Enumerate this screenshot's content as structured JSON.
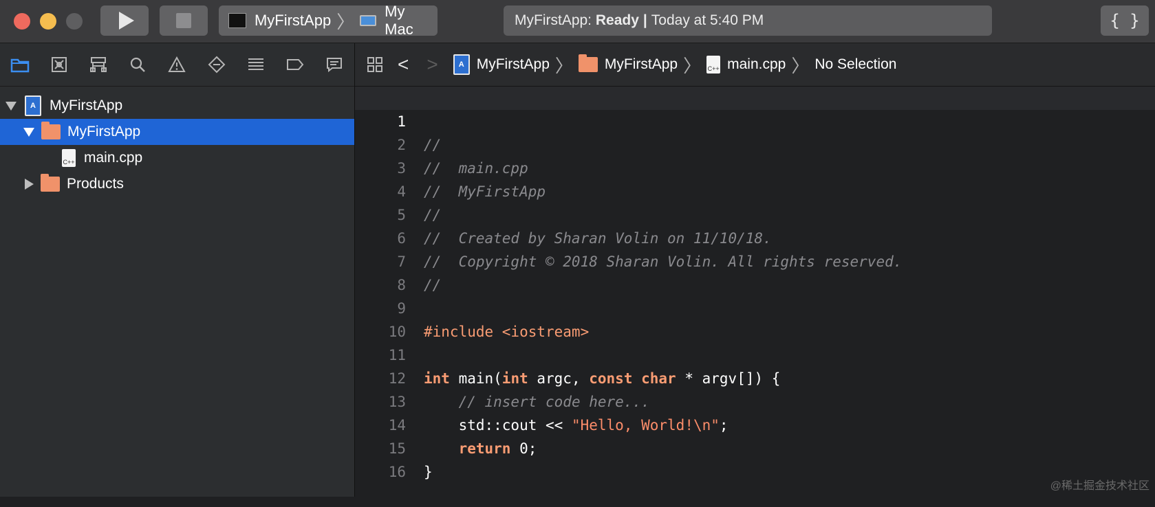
{
  "toolbar": {
    "scheme_name": "MyFirstApp",
    "destination": "My Mac",
    "status_app": "MyFirstApp:",
    "status_state": "Ready",
    "status_separator": "|",
    "status_time": "Today at 5:40 PM",
    "braces": "{ }"
  },
  "navigator": {
    "tree": [
      {
        "label": "MyFirstApp"
      },
      {
        "label": "MyFirstApp"
      },
      {
        "label": "main.cpp"
      },
      {
        "label": "Products"
      }
    ]
  },
  "jumpbar": {
    "project": "MyFirstApp",
    "group": "MyFirstApp",
    "file": "main.cpp",
    "selection": "No Selection"
  },
  "editor": {
    "line_numbers": [
      "1",
      "2",
      "3",
      "4",
      "5",
      "6",
      "7",
      "8",
      "9",
      "10",
      "11",
      "12",
      "13",
      "14",
      "15",
      "16"
    ],
    "comments": {
      "l1": "//",
      "l2": "//  main.cpp",
      "l3": "//  MyFirstApp",
      "l4": "//",
      "l5": "//  Created by Sharan Volin on 11/10/18.",
      "l6": "//  Copyright © 2018 Sharan Volin. All rights reserved.",
      "l7": "//",
      "l12": "// insert code here..."
    },
    "include_directive": "#include <iostream>",
    "main_sig": {
      "kw_int1": "int",
      "fn": " main(",
      "kw_int2": "int",
      "argc": " argc, ",
      "kw_const": "const",
      "sp": " ",
      "kw_char": "char",
      "rest": " * argv[]) {"
    },
    "cout_line": {
      "indent": "    ",
      "pre": "std::cout << ",
      "str": "\"Hello, World!\\n\"",
      "post": ";"
    },
    "return_line": {
      "indent": "    ",
      "kw": "return",
      "rest": " 0;"
    },
    "closing": "}"
  },
  "watermark": "@稀土掘金技术社区"
}
